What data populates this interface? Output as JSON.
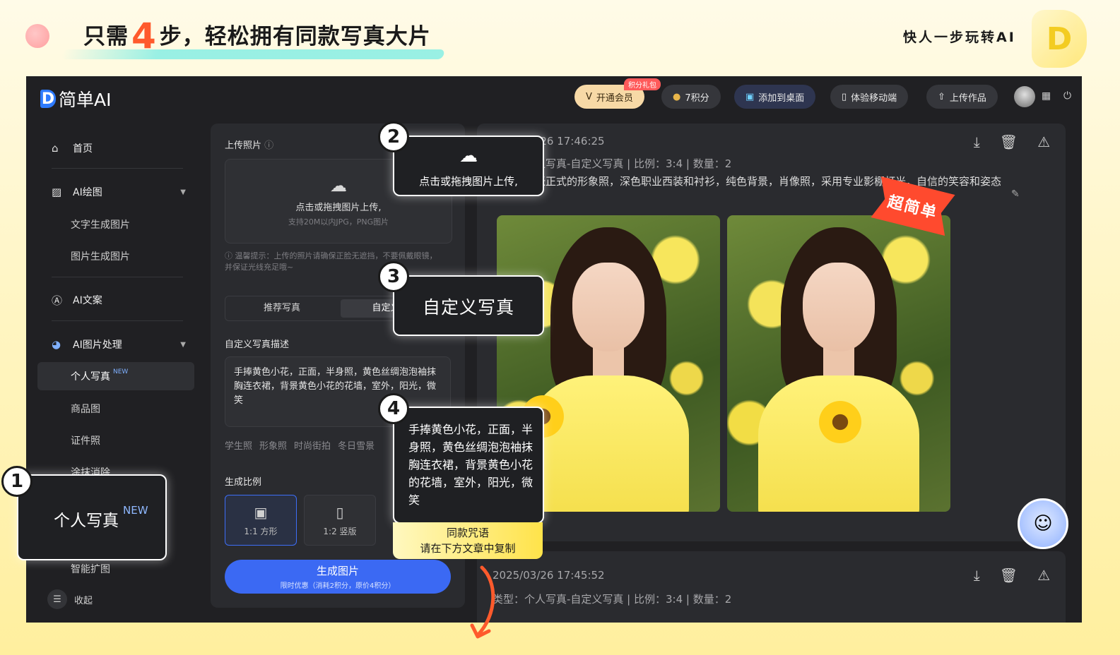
{
  "banner": {
    "headline_pre": "只需",
    "headline_num": "4",
    "headline_post": "步，轻松拥有同款写真大片",
    "tagline": "快人一步玩转AI"
  },
  "app": {
    "brand": "简单AI",
    "topbar": {
      "gift_badge": "积分礼包",
      "vip_label": "开通会员",
      "points_label": "7积分",
      "desktop_label": "添加到桌面",
      "mobile_label": "体验移动端",
      "upload_work_label": "上传作品"
    },
    "sidebar": {
      "home": "首页",
      "ai_drawing": "AI绘图",
      "text_to_image": "文字生成图片",
      "image_to_image": "图片生成图片",
      "ai_copy": "AI文案",
      "ai_image_process": "AI图片处理",
      "portrait": "个人写真",
      "portrait_badge": "NEW",
      "product_image": "商品图",
      "id_photo": "证件照",
      "erase": "涂抹消除",
      "expand": "智能扩图",
      "collapse": "收起"
    },
    "panel": {
      "upload_title": "上传照片",
      "upload_main": "点击或拖拽图片上传,",
      "upload_sub": "支持20M以内JPG，PNG图片",
      "tip": "温馨提示：上传的照片请确保正脸无遮挡，不要佩戴眼镜，并保证光线充足哦~",
      "tab_recommended": "推荐写真",
      "tab_custom": "自定义写真",
      "desc_title": "自定义写真描述",
      "desc_text": "手捧黄色小花，正面，半身照，黄色丝绸泡泡袖抹胸连衣裙，背景黄色小花的花墙，室外，阳光，微笑",
      "chips": [
        "学生照",
        "形象照",
        "时尚街拍",
        "冬日雪景"
      ],
      "ratio_title": "生成比例",
      "ratios": [
        "1:1 方形",
        "1:2 竖版"
      ],
      "generate_label": "生成图片",
      "generate_promo": "限时优惠（消耗2积分，原价4积分）"
    },
    "results": [
      {
        "date": "2025/03/26 17:46:25",
        "type": "类型：个人写真-自定义写真 | 比例：3:4 | 数量：2",
        "prompt": "描述：一张正式的形象照，深色职业西装和衬衫，纯色背景，肖像照，采用专业影棚灯光，自信的笑容和姿态"
      },
      {
        "date": "2025/03/26 17:45:52",
        "type": "类型：个人写真-自定义写真 | 比例：3:4 | 数量：2"
      }
    ],
    "badge": "超简单"
  },
  "callouts": {
    "step1_num": "1",
    "step1_text": "个人写真",
    "step1_badge": "NEW",
    "step2_num": "2",
    "step2_text": "点击或拖拽图片上传,",
    "step3_num": "3",
    "step3_text": "自定义写真",
    "step4_num": "4",
    "step4_text": "手捧黄色小花，正面，半身照，黄色丝绸泡泡袖抹胸连衣裙，背景黄色小花的花墙，室外，阳光，微笑",
    "step4_bar_line1": "同款咒语",
    "step4_bar_line2": "请在下方文章中复制"
  },
  "colors": {
    "accent_blue": "#3b69f3",
    "badge_red": "#ff4a2e",
    "headline_num": "#ff5a2c"
  }
}
